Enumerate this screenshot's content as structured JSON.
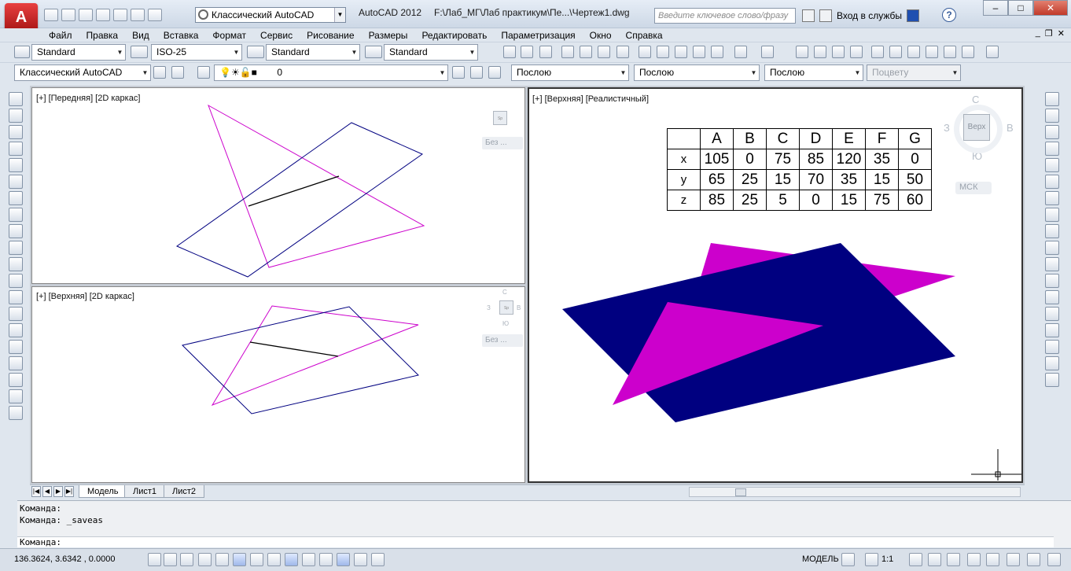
{
  "window": {
    "title": "AutoCAD 2012",
    "file_path": "F:\\Лаб_МГ\\Лаб практикум\\Пе...\\Чертеж1.dwg",
    "workspace": "Классический AutoCAD",
    "search_placeholder": "Введите ключевое слово/фразу",
    "login_label": "Вход в службы",
    "help_label": "?",
    "minimize": "–",
    "maximize": "□",
    "close": "✕",
    "app_letter": "A"
  },
  "menu": {
    "items": [
      "Файл",
      "Правка",
      "Вид",
      "Вставка",
      "Формат",
      "Сервис",
      "Рисование",
      "Размеры",
      "Редактировать",
      "Параметризация",
      "Окно",
      "Справка"
    ],
    "mdi_min": "_",
    "mdi_restore": "❐",
    "mdi_close": "✕"
  },
  "styles_toolbar": {
    "text_style": "Standard",
    "dim_style": "ISO-25",
    "table_style": "Standard",
    "mleader_style": "Standard"
  },
  "layers_toolbar": {
    "workspace": "Классический AutoCAD",
    "layer": "0",
    "color": "Послою",
    "linetype": "Послою",
    "lineweight": "Послою",
    "plotstyle": "Поцвету"
  },
  "viewports": {
    "front": {
      "label": "[+] [Передняя] [2D каркас]",
      "visual": "Без ..."
    },
    "top2d": {
      "label": "[+] [Верхняя] [2D каркас]",
      "visual": "Без ...",
      "n": "С",
      "s": "Ю",
      "w": "З",
      "e": "В"
    },
    "top3d": {
      "label": "[+] [Верхняя] [Реалистичный]",
      "cube_face": "Верх",
      "n": "С",
      "s": "Ю",
      "w": "З",
      "e": "В",
      "ucs": "МСК"
    }
  },
  "points_table": {
    "columns": [
      "A",
      "B",
      "C",
      "D",
      "E",
      "F",
      "G"
    ],
    "rows": [
      {
        "label": "x",
        "values": [
          "105",
          "0",
          "75",
          "85",
          "120",
          "35",
          "0"
        ]
      },
      {
        "label": "y",
        "values": [
          "65",
          "25",
          "15",
          "70",
          "35",
          "15",
          "50"
        ]
      },
      {
        "label": "z",
        "values": [
          "85",
          "25",
          "5",
          "0",
          "15",
          "75",
          "60"
        ]
      }
    ]
  },
  "layout_tabs": [
    "Модель",
    "Лист1",
    "Лист2"
  ],
  "command": {
    "history": [
      "Команда:",
      "Команда:  _saveas"
    ],
    "prompt": "Команда:"
  },
  "status": {
    "coords": "136.3624, 3.6342 , 0.0000",
    "model": "МОДЕЛЬ",
    "scale": "1:1"
  },
  "colors": {
    "triangle": "#cc00cc",
    "quad": "#000080",
    "segment": "#000000"
  }
}
